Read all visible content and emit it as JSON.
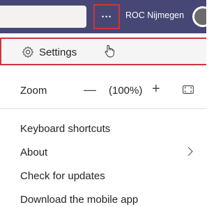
{
  "header": {
    "more_label": "···",
    "org_name": "ROC Nijmegen"
  },
  "menu": {
    "settings": {
      "label": "Settings",
      "icon": "gear-icon"
    },
    "zoom": {
      "label": "Zoom",
      "minus": "—",
      "value": "(100%)",
      "plus": "+"
    },
    "items": [
      {
        "label": "Keyboard shortcuts"
      },
      {
        "label": "About",
        "icon": "chevron-right-icon"
      },
      {
        "label": "Check for updates"
      },
      {
        "label": "Download the mobile app"
      }
    ]
  },
  "colors": {
    "header_bg": "#464775",
    "highlight_border": "#d13438",
    "text": "#252423"
  }
}
